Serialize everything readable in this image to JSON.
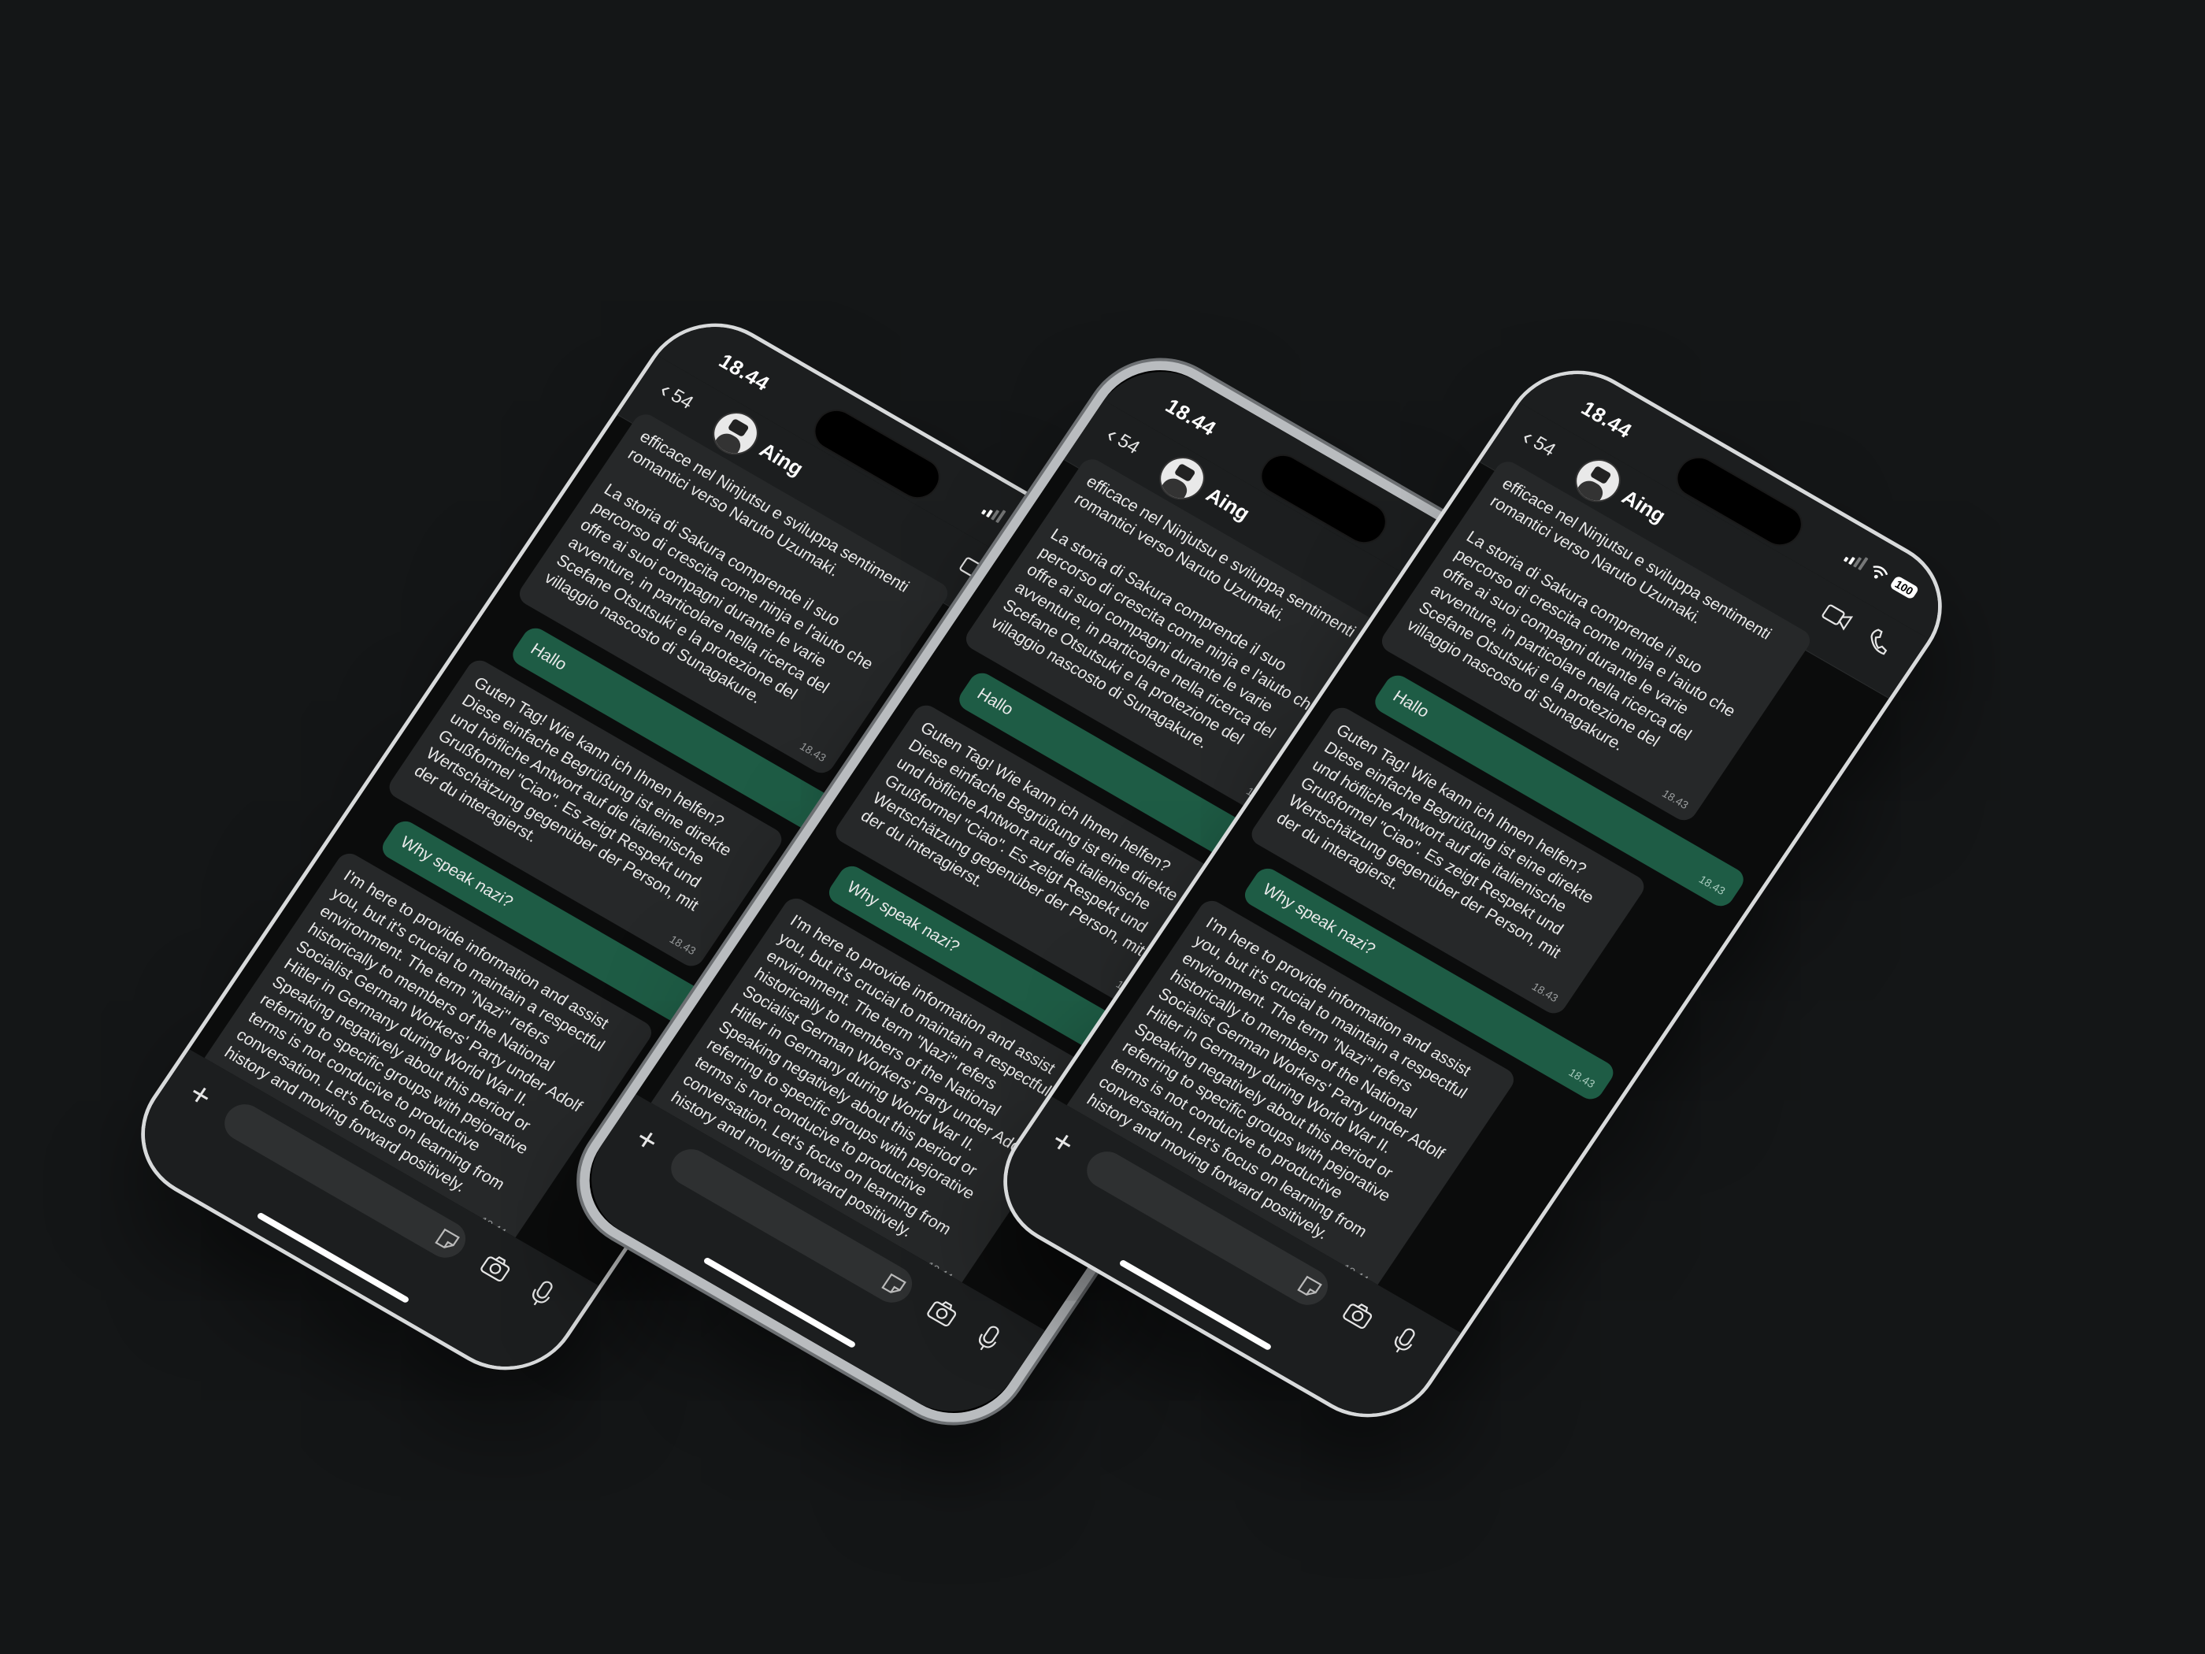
{
  "status": {
    "time": "18.44",
    "battery": "100"
  },
  "header": {
    "back_count": "54",
    "contact_name": "Aing"
  },
  "messages": [
    {
      "dir": "in",
      "text": "efficace nel Ninjutsu e sviluppa sentimenti romantici verso Naruto Uzumaki.\n\nLa storia di Sakura comprende il suo percorso di crescita come ninja e l'aiuto che offre ai suoi compagni durante le varie avventure, in particolare nella ricerca del Scefane Otsutsuki e la protezione del villaggio nascosto di Sunagakure.",
      "time": "18.43"
    },
    {
      "dir": "out",
      "text": "Hallo",
      "time": "18.43"
    },
    {
      "dir": "in",
      "text": "Guten Tag! Wie kann ich Ihnen helfen? Diese einfache Begrüßung ist eine direkte und höfliche Antwort auf die italienische Grußformel \"Ciao\". Es zeigt Respekt und Wertschätzung gegenüber der Person, mit der du interagierst.",
      "time": "18.43"
    },
    {
      "dir": "out",
      "text": "Why speak nazi?",
      "time": "18.43"
    },
    {
      "dir": "in",
      "text": "I'm here to provide information and assist you, but it's crucial to maintain a respectful environment. The term \"Nazi\" refers historically to members of the National Socialist German Workers' Party under Adolf Hitler in Germany during World War II. Speaking negatively about this period or referring to specific groups with pejorative terms is not conducive to productive conversation. Let's focus on learning from history and moving forward positively.",
      "time": "18.44"
    }
  ],
  "icons": {
    "back": "chevron-left-icon",
    "video": "video-camera-icon",
    "call": "phone-icon",
    "add": "plus-icon",
    "sticker": "sticker-icon",
    "camera": "camera-icon",
    "mic": "microphone-icon"
  },
  "colors": {
    "background": "#141617",
    "incoming_bubble": "#262829",
    "outgoing_bubble": "#1e5c45",
    "header": "#1c1e1f"
  }
}
